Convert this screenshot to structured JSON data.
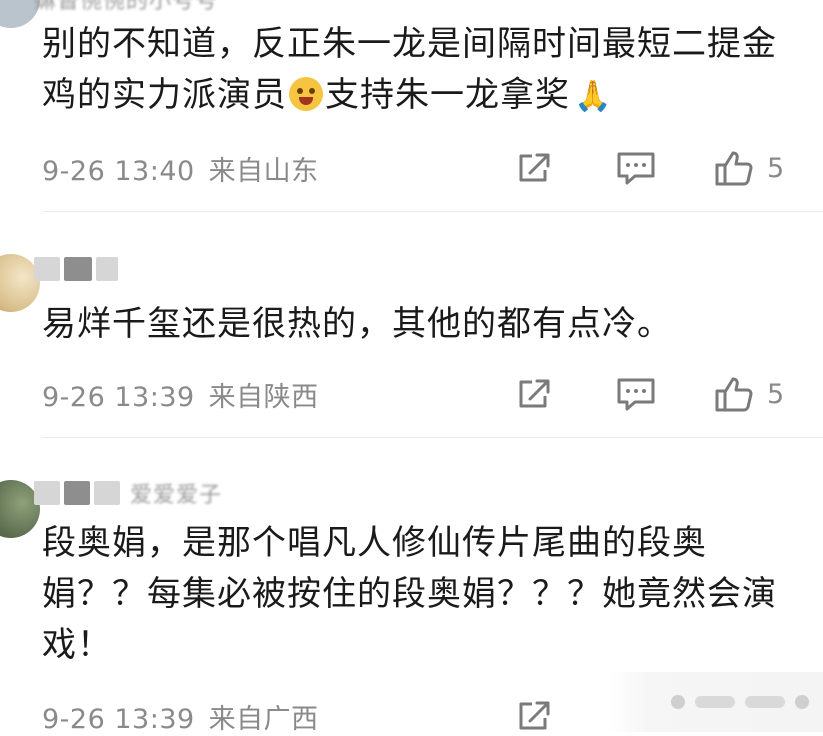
{
  "comments": [
    {
      "name_text": "嫲督惋惋的小号号",
      "text": "别的不知道，反正朱一龙是间隔时间最短二提金鸡的实力派演员",
      "text_after_emoji": "支持朱一龙拿奖",
      "emoji": "laughing-face-emoji",
      "trailing_emoji": "folded-hands-emoji",
      "date": "9-26 13:40",
      "location": "来自山东",
      "likes": "5"
    },
    {
      "name_text": "",
      "text": "易烊千玺还是很热的，其他的都有点冷。",
      "date": "9-26 13:39",
      "location": "来自陕西",
      "likes": "5"
    },
    {
      "name_text": "爱爱爱子",
      "text": "段奥娟，是那个唱凡人修仙传片尾曲的段奥娟？？每集必被按住的段奥娟？？？她竟然会演戏！",
      "date": "9-26 13:39",
      "location": "来自广西",
      "likes": ""
    }
  ],
  "icons": {
    "share": "share-icon",
    "reply": "comment-icon",
    "like": "thumbs-up-icon"
  }
}
